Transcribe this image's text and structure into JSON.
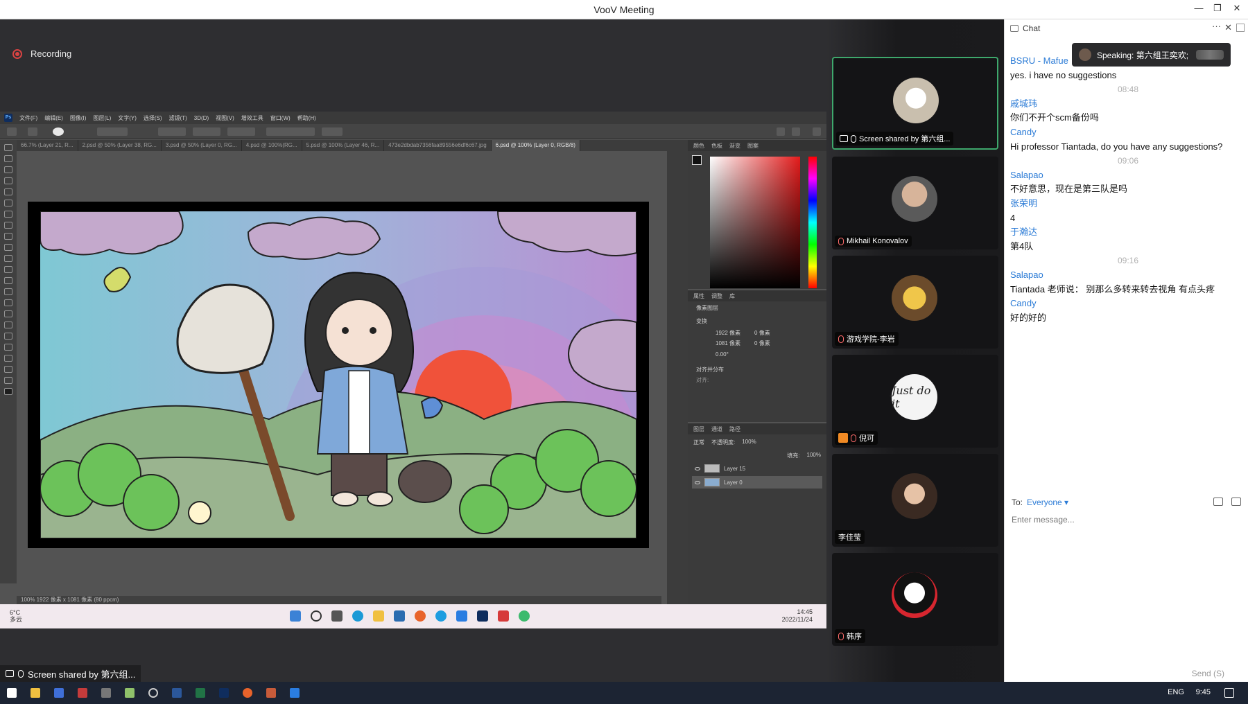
{
  "window": {
    "title": "VooV Meeting"
  },
  "recording": {
    "label": "Recording"
  },
  "photoshop": {
    "menus": [
      "文件(F)",
      "编辑(E)",
      "图像(I)",
      "图层(L)",
      "文字(Y)",
      "选择(S)",
      "滤镜(T)",
      "3D(D)",
      "视图(V)",
      "增效工具",
      "窗口(W)",
      "帮助(H)"
    ],
    "tabs": [
      "66.7% (Layer 21, R...",
      "2.psd @ 50% (Layer 38, RG...",
      "3.psd @ 50% (Layer 0, RG...",
      "4.psd @ 100%(RG...",
      "5.psd @ 100% (Layer 46, R...",
      "473e2dbdab7356faa89556e6df6c67.jpg",
      "6.psd @ 100% (Layer 0, RGB/8)"
    ],
    "active_tab_index": 6,
    "status": "100%   1922 像素 x 1081 像素 (80 ppcm)",
    "props": {
      "section": "变换",
      "w": "1922 像素",
      "h": "1081 像素",
      "x": "0 像素",
      "y": "0 像素",
      "angle": "0.00°",
      "align_section": "对齐并分布",
      "align_label": "对齐:",
      "layer_kind": "像素图层"
    },
    "layers_panel": {
      "tabs": [
        "图层",
        "通道",
        "路径"
      ],
      "blend": "正常",
      "opacity_label": "不透明度:",
      "opacity": "100%",
      "fill_label": "填充:",
      "fill": "100%",
      "layers": [
        "Layer 15",
        "Layer 0"
      ]
    },
    "panel_tabs_color": [
      "颜色",
      "色板",
      "渐变",
      "图案"
    ],
    "panel_tabs_props": [
      "属性",
      "调整",
      "库"
    ]
  },
  "inner_taskbar": {
    "weather_temp": "6°C",
    "weather_desc": "多云",
    "time": "14:45",
    "date": "2022/11/24"
  },
  "screen_share_label": "Screen shared by 第六组...",
  "participants": [
    {
      "name": "Screen shared by 第六组...",
      "active": true,
      "avatar_color": "#d9d3c8"
    },
    {
      "name": "Mikhail Konovalov",
      "active": false,
      "avatar_color": "#8a7b6e"
    },
    {
      "name": "游戏学院-李岩",
      "active": false,
      "avatar_color": "#c8a45a"
    },
    {
      "name": "倪可",
      "active": false,
      "avatar_color": "#f4f4f4"
    },
    {
      "name": "李佳莹",
      "active": false,
      "avatar_color": "#7a5a48"
    },
    {
      "name": "韩序",
      "active": false,
      "avatar_color": "#ffffff"
    }
  ],
  "chat": {
    "title": "Chat",
    "speaking": "Speaking: 第六组王奕欢;",
    "messages": [
      {
        "type": "sender",
        "text": "BSRU - Mafue"
      },
      {
        "type": "body",
        "text": "yes. i have no suggestions"
      },
      {
        "type": "stamp",
        "text": "08:48"
      },
      {
        "type": "sender",
        "text": "戚城玮"
      },
      {
        "type": "body",
        "text": "你们不开个scm备份吗"
      },
      {
        "type": "sender",
        "text": "Candy"
      },
      {
        "type": "body",
        "text": "Hi professor Tiantada,  do you have any suggestions?"
      },
      {
        "type": "stamp",
        "text": "09:06"
      },
      {
        "type": "sender",
        "text": "Salapao"
      },
      {
        "type": "body",
        "text": "不好意思，现在是第三队是吗"
      },
      {
        "type": "sender",
        "text": "张荣明"
      },
      {
        "type": "body",
        "text": "4"
      },
      {
        "type": "sender",
        "text": "于瀚达"
      },
      {
        "type": "body",
        "text": "第4队"
      },
      {
        "type": "stamp",
        "text": "09:16"
      },
      {
        "type": "sender",
        "text": "Salapao"
      },
      {
        "type": "body",
        "text": "Tiantada 老师说：  别那么多转来转去视角 有点头疼"
      },
      {
        "type": "sender",
        "text": "Candy"
      },
      {
        "type": "body",
        "text": "好的好的"
      }
    ],
    "to_label": "To:",
    "to_value": "Everyone ▾",
    "input_placeholder": "Enter message...",
    "send_label": "Send (S)"
  },
  "host_taskbar": {
    "lang": "ENG",
    "time": "9:45"
  },
  "colors": {
    "accent_blue": "#2b7bd6",
    "active_border": "#3ea86c",
    "rec_red": "#d94343"
  },
  "icons": [
    "record-icon",
    "mic-icon",
    "share-screen-icon",
    "chat-icon",
    "close-icon",
    "more-icon",
    "windows-start-icon",
    "search-icon"
  ]
}
